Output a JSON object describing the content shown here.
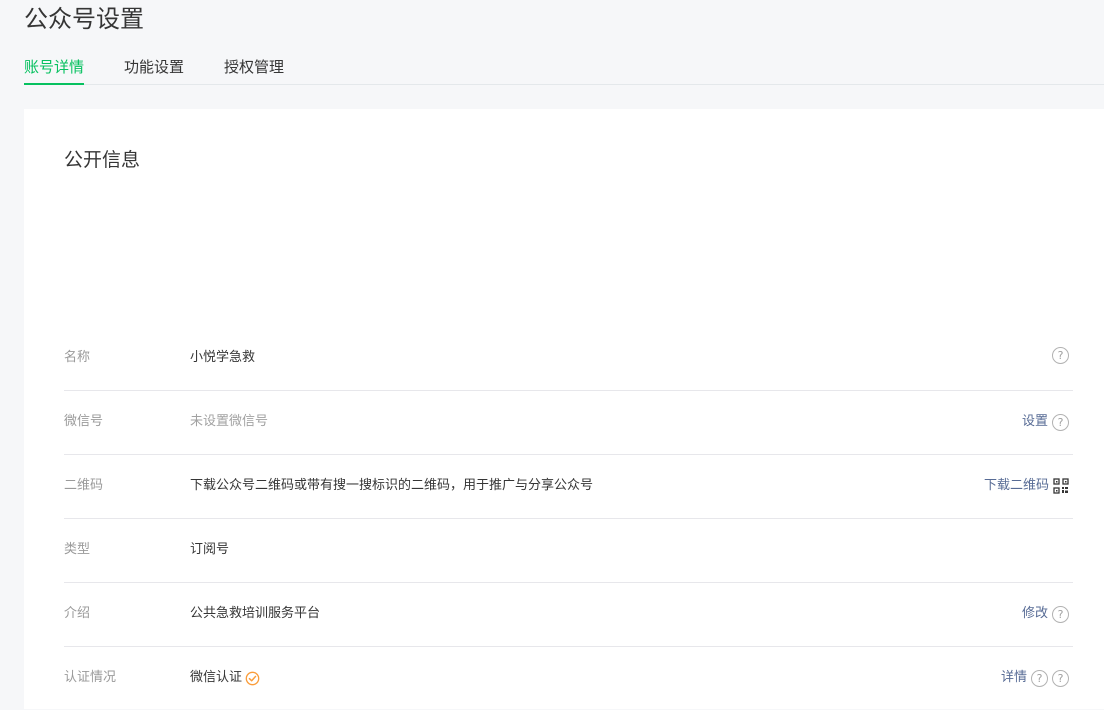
{
  "header": {
    "title": "公众号设置"
  },
  "tabs": [
    {
      "label": "账号详情",
      "active": true
    },
    {
      "label": "功能设置",
      "active": false
    },
    {
      "label": "授权管理",
      "active": false
    }
  ],
  "section": {
    "title": "公开信息"
  },
  "rows": {
    "name": {
      "label": "名称",
      "value": "小悦学急救"
    },
    "wechat_id": {
      "label": "微信号",
      "value": "未设置微信号",
      "action": "设置"
    },
    "qrcode": {
      "label": "二维码",
      "value": "下载公众号二维码或带有搜一搜标识的二维码，用于推广与分享公众号",
      "action": "下载二维码"
    },
    "type": {
      "label": "类型",
      "value": "订阅号"
    },
    "intro": {
      "label": "介绍",
      "value": "公共急救培训服务平台",
      "action": "修改"
    },
    "verification": {
      "label": "认证情况",
      "value": "微信认证",
      "action": "详情"
    }
  },
  "icons": {
    "help": "question-circle-icon",
    "qr": "qr-code-icon",
    "verified": "verified-check-icon"
  },
  "colors": {
    "accent": "#07c160",
    "link": "#576b95",
    "verified": "#fa9d3b"
  }
}
